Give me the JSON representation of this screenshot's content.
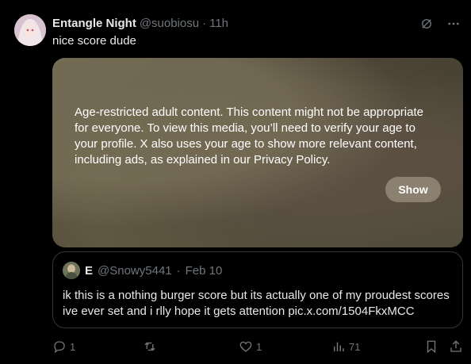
{
  "post": {
    "author_name": "Entangle Night",
    "author_handle": "@suobiosu",
    "separator": "·",
    "time": "11h",
    "text": "nice score dude",
    "media_notice": "Age-restricted adult content. This content might not be appropriate for everyone. To view this media, you’ll need to verify your age to your profile. X also uses your age to show more relevant content, including ads, as explained in our Privacy Policy.",
    "show_label": "Show"
  },
  "quote": {
    "author_name": "E",
    "author_handle": "@Snowy5441",
    "separator": "·",
    "date": "Feb 10",
    "text": "ik this is a nothing burger score but its actually one of my proudest scores ive ever set and i rlly hope it gets attention pic.x.com/1504FkxMCC"
  },
  "actions": {
    "replies": "1",
    "likes": "1",
    "views": "71"
  },
  "icons": [
    "grok-icon",
    "more-icon",
    "reply-icon",
    "repost-icon",
    "like-icon",
    "views-icon",
    "bookmark-icon",
    "share-icon"
  ],
  "colors": {
    "background": "#000000",
    "text": "#e7e9ea",
    "muted": "#71767b",
    "border": "#333639"
  }
}
